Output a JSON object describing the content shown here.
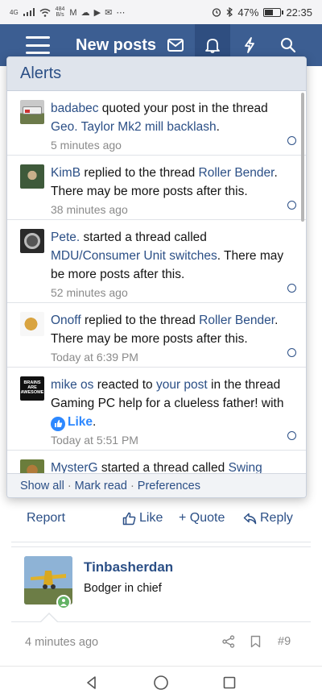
{
  "status_bar": {
    "network": "4G",
    "speed_value": "484",
    "speed_unit": "B/s",
    "extra_icons": "M ☁ ▶ ✉ ⋯",
    "battery": "47%",
    "battery_level": 0.47,
    "time": "22:35"
  },
  "header": {
    "title": "New posts",
    "icons": [
      "menu-icon",
      "mail-icon",
      "bell-icon",
      "lightning-icon",
      "search-icon"
    ]
  },
  "alerts": {
    "title": "Alerts",
    "items": [
      {
        "user": "badabec",
        "text1": " quoted your post in the thread ",
        "link": "Geo. Taylor Mk2 mill backlash",
        "text2": ".",
        "time": "5 minutes ago"
      },
      {
        "user": "KimB",
        "text1": " replied to the thread ",
        "link": "Roller Bender",
        "text2": ". There may be more posts after this.",
        "time": "38 minutes ago"
      },
      {
        "user": "Pete.",
        "text1": " started a thread called ",
        "link": "MDU/Consumer Unit switches",
        "text2": ". There may be more posts after this.",
        "time": "52 minutes ago"
      },
      {
        "user": "Onoff",
        "text1": " replied to the thread ",
        "link": "Roller Bender",
        "text2": ". There may be more posts after this.",
        "time": "Today at 6:39 PM"
      },
      {
        "user": "mike os",
        "text1": " reacted to ",
        "link": "your post",
        "text2": " in the thread Gaming PC help for a clueless father! with ",
        "reaction": "Like",
        "text3": ".",
        "avatar_text": "BRAINS ARE AWESOME",
        "time": "Today at 5:51 PM"
      },
      {
        "user": "MysterG",
        "text1": " started a thread called ",
        "link": "Swing",
        "text2": ""
      }
    ],
    "footer": {
      "show_all": "Show all",
      "sep": "·",
      "mark_read": "Mark read",
      "preferences": "Preferences"
    }
  },
  "post_actions": {
    "report": "Report",
    "like": "Like",
    "quote": "+ Quote",
    "reply": "Reply"
  },
  "post_user": {
    "name": "Tinbasherdan",
    "title": "Bodger in chief",
    "time": "4 minutes ago",
    "post_number": "#9"
  }
}
